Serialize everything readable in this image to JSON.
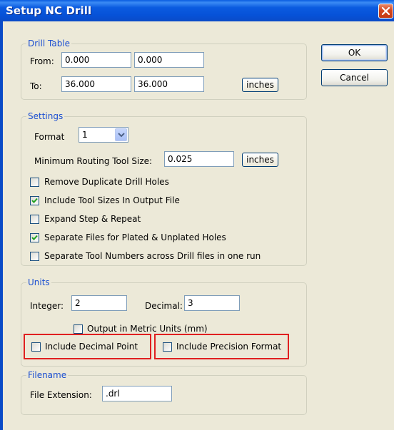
{
  "window": {
    "title": "Setup NC Drill"
  },
  "drill_table": {
    "legend": "Drill Table",
    "from_label": "From:",
    "from_x": "0.000",
    "from_y": "0.000",
    "to_label": "To:",
    "to_x": "36.000",
    "to_y": "36.000",
    "units_button": "inches"
  },
  "buttons": {
    "ok": "OK",
    "cancel": "Cancel"
  },
  "settings": {
    "legend": "Settings",
    "format_label": "Format",
    "format_value": "1",
    "min_tool_label": "Minimum Routing Tool Size:",
    "min_tool_value": "0.025",
    "units_button": "inches",
    "options": [
      {
        "label": "Remove Duplicate Drill Holes",
        "checked": false
      },
      {
        "label": "Include Tool Sizes In Output File",
        "checked": true
      },
      {
        "label": "Expand Step & Repeat",
        "checked": false
      },
      {
        "label": "Separate Files for Plated & Unplated Holes",
        "checked": true
      },
      {
        "label": "Separate Tool Numbers across Drill files in one run",
        "checked": false
      }
    ]
  },
  "units": {
    "legend": "Units",
    "integer_label": "Integer:",
    "integer_value": "2",
    "decimal_label": "Decimal:",
    "decimal_value": "3",
    "metric_label": "Output in Metric Units (mm)",
    "metric_checked": false,
    "decimal_point_label": "Include Decimal Point",
    "decimal_point_checked": false,
    "precision_label": "Include Precision Format",
    "precision_checked": false
  },
  "filename": {
    "legend": "Filename",
    "ext_label": "File Extension:",
    "ext_value": ".drl"
  },
  "colors": {
    "highlight_box": "#e02020",
    "title_bar": "#0a5ce0",
    "legend_text": "#1b4fd1"
  }
}
